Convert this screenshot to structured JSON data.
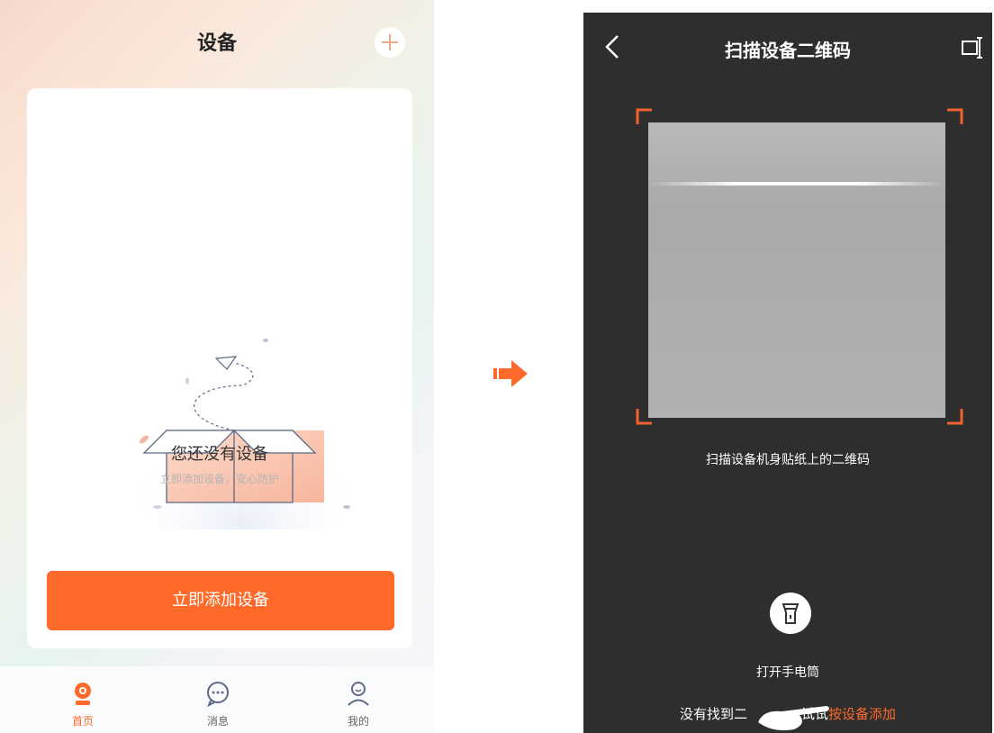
{
  "left_screen": {
    "title": "设备",
    "empty_title": "您还没有设备",
    "empty_subtitle": "立即添加设备，安心防护",
    "add_button": "立即添加设备",
    "tabs": [
      {
        "label": "首页",
        "icon": "camera-icon",
        "active": true
      },
      {
        "label": "消息",
        "icon": "chat-bubble-icon",
        "active": false
      },
      {
        "label": "我的",
        "icon": "user-icon",
        "active": false
      }
    ]
  },
  "right_screen": {
    "title": "扫描设备二维码",
    "scan_hint": "扫描设备机身贴纸上的二维码",
    "flashlight_label": "打开手电筒",
    "not_found_prefix": "没有找到二",
    "not_found_middle": "试试",
    "not_found_link": "按设备添加"
  },
  "colors": {
    "accent": "#ff6a2a",
    "dark_bg": "#2e2e2e",
    "scan_corner": "#f2622a"
  }
}
